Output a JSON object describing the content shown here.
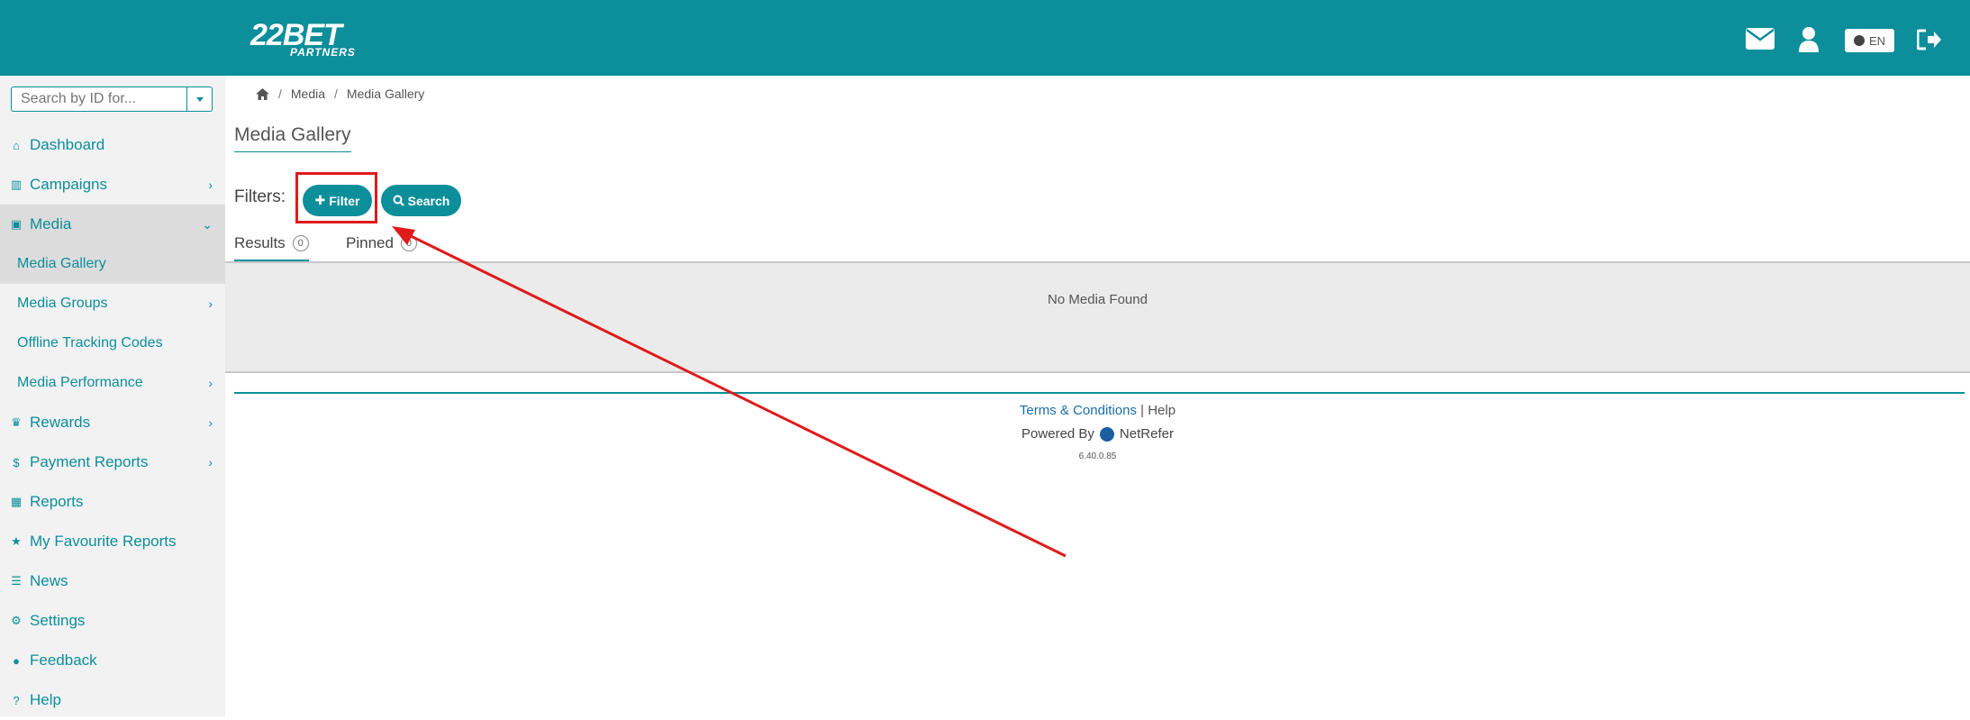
{
  "header": {
    "logo_main": "22BET",
    "logo_sub": "PARTNERS",
    "language": "EN"
  },
  "sidebar": {
    "search_placeholder": "Search by ID for...",
    "items": [
      {
        "label": "Dashboard",
        "icon": "home-icon"
      },
      {
        "label": "Campaigns",
        "icon": "bar-chart-icon"
      },
      {
        "label": "Media",
        "icon": "image-icon"
      },
      {
        "label": "Media Gallery"
      },
      {
        "label": "Media Groups"
      },
      {
        "label": "Offline Tracking Codes"
      },
      {
        "label": "Media Performance"
      },
      {
        "label": "Rewards",
        "icon": "trophy-icon"
      },
      {
        "label": "Payment Reports",
        "icon": "dollar-icon"
      },
      {
        "label": "Reports",
        "icon": "table-icon"
      },
      {
        "label": "My Favourite Reports",
        "icon": "star-icon"
      },
      {
        "label": "News",
        "icon": "list-icon"
      },
      {
        "label": "Settings",
        "icon": "gear-icon"
      },
      {
        "label": "Feedback",
        "icon": "chat-icon"
      },
      {
        "label": "Help",
        "icon": "help-icon"
      }
    ]
  },
  "breadcrumb": {
    "items": [
      "Media",
      "Media Gallery"
    ]
  },
  "page": {
    "title": "Media Gallery",
    "filters_label": "Filters:",
    "filter_button": "Filter",
    "search_button": "Search"
  },
  "tabs": [
    {
      "label": "Results",
      "count": "0"
    },
    {
      "label": "Pinned",
      "count": "0"
    }
  ],
  "results": {
    "empty_message": "No Media Found"
  },
  "footer": {
    "terms": "Terms & Conditions",
    "separator": "|",
    "help": "Help",
    "powered_by": "Powered By",
    "brand": "NetRefer",
    "version": "6.40.0.85"
  },
  "colors": {
    "brand": "#0c8e9b",
    "annotation": "#e01b1b"
  }
}
